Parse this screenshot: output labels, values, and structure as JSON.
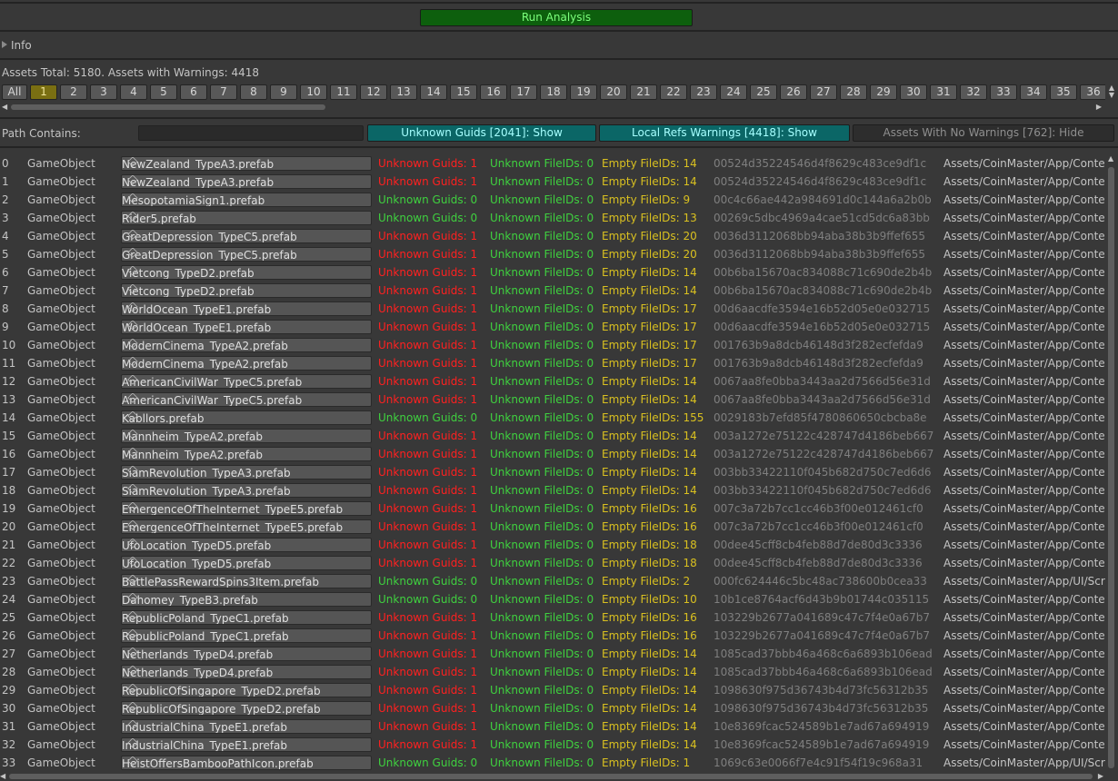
{
  "run_button": "Run Analysis",
  "info_label": "Info",
  "totals": "Assets Total: 5180. Assets with Warnings: 4418",
  "pages": [
    "All",
    "1",
    "2",
    "3",
    "4",
    "5",
    "6",
    "7",
    "8",
    "9",
    "10",
    "11",
    "12",
    "13",
    "14",
    "15",
    "16",
    "17",
    "18",
    "19",
    "20",
    "21",
    "22",
    "23",
    "24",
    "25",
    "26",
    "27",
    "28",
    "29",
    "30",
    "31",
    "32",
    "33",
    "34",
    "35",
    "36"
  ],
  "selected_page": "1",
  "path_label": "Path Contains:",
  "path_value": "",
  "toggles": {
    "unknown_guids": "Unknown Guids [2041]: Show",
    "local_refs": "Local Refs Warnings [4418]: Show",
    "no_warnings": "Assets With No Warnings [762]: Hide"
  },
  "colors": {
    "warning_red": "#ff2020",
    "ok_green": "#3fd13f",
    "empty_yellow": "#d9c020",
    "selected_page": "#7a6f12",
    "toggle_on": "#0b6666"
  },
  "icons": {
    "object_field": "prefab-cube-icon",
    "foldout": "foldout-triangle-icon"
  },
  "rows": [
    {
      "idx": "0",
      "type": "GameObject",
      "name": "NewZealand_TypeA3.prefab",
      "guids": "Unknown Guids: 1",
      "bad": true,
      "fileids": "Unknown FileIDs: 0",
      "empty": "Empty FileIDs: 14",
      "hash": "00524d35224546d4f8629c483ce9df1c",
      "path": "Assets/CoinMaster/App/Conten"
    },
    {
      "idx": "1",
      "type": "GameObject",
      "name": "NewZealand_TypeA3.prefab",
      "guids": "Unknown Guids: 1",
      "bad": true,
      "fileids": "Unknown FileIDs: 0",
      "empty": "Empty FileIDs: 14",
      "hash": "00524d35224546d4f8629c483ce9df1c",
      "path": "Assets/CoinMaster/App/Conten"
    },
    {
      "idx": "2",
      "type": "GameObject",
      "name": "MesopotamiaSign1.prefab",
      "guids": "Unknown Guids: 0",
      "bad": false,
      "fileids": "Unknown FileIDs: 0",
      "empty": "Empty FileIDs: 9",
      "hash": "00c4c66ae442a984691d0c144a6a2b0b",
      "path": "Assets/CoinMaster/App/Conten"
    },
    {
      "idx": "3",
      "type": "GameObject",
      "name": "Rider5.prefab",
      "guids": "Unknown Guids: 0",
      "bad": false,
      "fileids": "Unknown FileIDs: 0",
      "empty": "Empty FileIDs: 13",
      "hash": "00269c5dbc4969a4cae51cd5dc6a83bb",
      "path": "Assets/CoinMaster/App/Conten"
    },
    {
      "idx": "4",
      "type": "GameObject",
      "name": "GreatDepression_TypeC5.prefab",
      "guids": "Unknown Guids: 1",
      "bad": true,
      "fileids": "Unknown FileIDs: 0",
      "empty": "Empty FileIDs: 20",
      "hash": "0036d3112068bb94aba38b3b9ffef655",
      "path": "Assets/CoinMaster/App/Conten"
    },
    {
      "idx": "5",
      "type": "GameObject",
      "name": "GreatDepression_TypeC5.prefab",
      "guids": "Unknown Guids: 1",
      "bad": true,
      "fileids": "Unknown FileIDs: 0",
      "empty": "Empty FileIDs: 20",
      "hash": "0036d3112068bb94aba38b3b9ffef655",
      "path": "Assets/CoinMaster/App/Conten"
    },
    {
      "idx": "6",
      "type": "GameObject",
      "name": "Vietcong_TypeD2.prefab",
      "guids": "Unknown Guids: 1",
      "bad": true,
      "fileids": "Unknown FileIDs: 0",
      "empty": "Empty FileIDs: 14",
      "hash": "00b6ba15670ac834088c71c690de2b4b",
      "path": "Assets/CoinMaster/App/Conten"
    },
    {
      "idx": "7",
      "type": "GameObject",
      "name": "Vietcong_TypeD2.prefab",
      "guids": "Unknown Guids: 1",
      "bad": true,
      "fileids": "Unknown FileIDs: 0",
      "empty": "Empty FileIDs: 14",
      "hash": "00b6ba15670ac834088c71c690de2b4b",
      "path": "Assets/CoinMaster/App/Conten"
    },
    {
      "idx": "8",
      "type": "GameObject",
      "name": "WorldOcean_TypeE1.prefab",
      "guids": "Unknown Guids: 1",
      "bad": true,
      "fileids": "Unknown FileIDs: 0",
      "empty": "Empty FileIDs: 17",
      "hash": "00d6aacdfe3594e16b52d05e0e032715",
      "path": "Assets/CoinMaster/App/Conten"
    },
    {
      "idx": "9",
      "type": "GameObject",
      "name": "WorldOcean_TypeE1.prefab",
      "guids": "Unknown Guids: 1",
      "bad": true,
      "fileids": "Unknown FileIDs: 0",
      "empty": "Empty FileIDs: 17",
      "hash": "00d6aacdfe3594e16b52d05e0e032715",
      "path": "Assets/CoinMaster/App/Conten"
    },
    {
      "idx": "10",
      "type": "GameObject",
      "name": "ModernCinema_TypeA2.prefab",
      "guids": "Unknown Guids: 1",
      "bad": true,
      "fileids": "Unknown FileIDs: 0",
      "empty": "Empty FileIDs: 17",
      "hash": "001763b9a8dcb46148d3f282ecfefda9",
      "path": "Assets/CoinMaster/App/Conten"
    },
    {
      "idx": "11",
      "type": "GameObject",
      "name": "ModernCinema_TypeA2.prefab",
      "guids": "Unknown Guids: 1",
      "bad": true,
      "fileids": "Unknown FileIDs: 0",
      "empty": "Empty FileIDs: 17",
      "hash": "001763b9a8dcb46148d3f282ecfefda9",
      "path": "Assets/CoinMaster/App/Conten"
    },
    {
      "idx": "12",
      "type": "GameObject",
      "name": "AmericanCivilWar_TypeC5.prefab",
      "guids": "Unknown Guids: 1",
      "bad": true,
      "fileids": "Unknown FileIDs: 0",
      "empty": "Empty FileIDs: 14",
      "hash": "0067aa8fe0bba3443aa2d7566d56e31d",
      "path": "Assets/CoinMaster/App/Conten"
    },
    {
      "idx": "13",
      "type": "GameObject",
      "name": "AmericanCivilWar_TypeC5.prefab",
      "guids": "Unknown Guids: 1",
      "bad": true,
      "fileids": "Unknown FileIDs: 0",
      "empty": "Empty FileIDs: 14",
      "hash": "0067aa8fe0bba3443aa2d7566d56e31d",
      "path": "Assets/CoinMaster/App/Conten"
    },
    {
      "idx": "14",
      "type": "GameObject",
      "name": "Kabllors.prefab",
      "guids": "Unknown Guids: 0",
      "bad": false,
      "fileids": "Unknown FileIDs: 0",
      "empty": "Empty FileIDs: 155",
      "hash": "0029183b7efd85f4780860650cbcba8e",
      "path": "Assets/CoinMaster/App/Conten"
    },
    {
      "idx": "15",
      "type": "GameObject",
      "name": "Mannheim_TypeA2.prefab",
      "guids": "Unknown Guids: 1",
      "bad": true,
      "fileids": "Unknown FileIDs: 0",
      "empty": "Empty FileIDs: 14",
      "hash": "003a1272e75122c428747d4186beb667",
      "path": "Assets/CoinMaster/App/Conten"
    },
    {
      "idx": "16",
      "type": "GameObject",
      "name": "Mannheim_TypeA2.prefab",
      "guids": "Unknown Guids: 1",
      "bad": true,
      "fileids": "Unknown FileIDs: 0",
      "empty": "Empty FileIDs: 14",
      "hash": "003a1272e75122c428747d4186beb667",
      "path": "Assets/CoinMaster/App/Conten"
    },
    {
      "idx": "17",
      "type": "GameObject",
      "name": "SiamRevolution_TypeA3.prefab",
      "guids": "Unknown Guids: 1",
      "bad": true,
      "fileids": "Unknown FileIDs: 0",
      "empty": "Empty FileIDs: 14",
      "hash": "003bb33422110f045b682d750c7ed6d6",
      "path": "Assets/CoinMaster/App/Conten"
    },
    {
      "idx": "18",
      "type": "GameObject",
      "name": "SiamRevolution_TypeA3.prefab",
      "guids": "Unknown Guids: 1",
      "bad": true,
      "fileids": "Unknown FileIDs: 0",
      "empty": "Empty FileIDs: 14",
      "hash": "003bb33422110f045b682d750c7ed6d6",
      "path": "Assets/CoinMaster/App/Conten"
    },
    {
      "idx": "19",
      "type": "GameObject",
      "name": "EmergenceOfTheInternet_TypeE5.prefab",
      "guids": "Unknown Guids: 1",
      "bad": true,
      "fileids": "Unknown FileIDs: 0",
      "empty": "Empty FileIDs: 16",
      "hash": "007c3a72b7cc1cc46b3f00e012461cf0",
      "path": "Assets/CoinMaster/App/Conten"
    },
    {
      "idx": "20",
      "type": "GameObject",
      "name": "EmergenceOfTheInternet_TypeE5.prefab",
      "guids": "Unknown Guids: 1",
      "bad": true,
      "fileids": "Unknown FileIDs: 0",
      "empty": "Empty FileIDs: 16",
      "hash": "007c3a72b7cc1cc46b3f00e012461cf0",
      "path": "Assets/CoinMaster/App/Conten"
    },
    {
      "idx": "21",
      "type": "GameObject",
      "name": "UfoLocation_TypeD5.prefab",
      "guids": "Unknown Guids: 1",
      "bad": true,
      "fileids": "Unknown FileIDs: 0",
      "empty": "Empty FileIDs: 18",
      "hash": "00dee45cff8cb4feb88d7de80d3c3336",
      "path": "Assets/CoinMaster/App/Conten"
    },
    {
      "idx": "22",
      "type": "GameObject",
      "name": "UfoLocation_TypeD5.prefab",
      "guids": "Unknown Guids: 1",
      "bad": true,
      "fileids": "Unknown FileIDs: 0",
      "empty": "Empty FileIDs: 18",
      "hash": "00dee45cff8cb4feb88d7de80d3c3336",
      "path": "Assets/CoinMaster/App/Conten"
    },
    {
      "idx": "23",
      "type": "GameObject",
      "name": "BattlePassRewardSpins3Item.prefab",
      "guids": "Unknown Guids: 0",
      "bad": false,
      "fileids": "Unknown FileIDs: 0",
      "empty": "Empty FileIDs: 2",
      "hash": "000fc624446c5bc48ac738600b0cea33",
      "path": "Assets/CoinMaster/App/UI/Scre"
    },
    {
      "idx": "24",
      "type": "GameObject",
      "name": "Dahomey_TypeB3.prefab",
      "guids": "Unknown Guids: 0",
      "bad": false,
      "fileids": "Unknown FileIDs: 0",
      "empty": "Empty FileIDs: 10",
      "hash": "10b1ce8764acf6d43b9b01744c035115",
      "path": "Assets/CoinMaster/App/Conten"
    },
    {
      "idx": "25",
      "type": "GameObject",
      "name": "RepublicPoland_TypeC1.prefab",
      "guids": "Unknown Guids: 1",
      "bad": true,
      "fileids": "Unknown FileIDs: 0",
      "empty": "Empty FileIDs: 16",
      "hash": "103229b2677a041689c47c7f4e0a67b7",
      "path": "Assets/CoinMaster/App/Conten"
    },
    {
      "idx": "26",
      "type": "GameObject",
      "name": "RepublicPoland_TypeC1.prefab",
      "guids": "Unknown Guids: 1",
      "bad": true,
      "fileids": "Unknown FileIDs: 0",
      "empty": "Empty FileIDs: 16",
      "hash": "103229b2677a041689c47c7f4e0a67b7",
      "path": "Assets/CoinMaster/App/Conten"
    },
    {
      "idx": "27",
      "type": "GameObject",
      "name": "Netherlands_TypeD4.prefab",
      "guids": "Unknown Guids: 1",
      "bad": true,
      "fileids": "Unknown FileIDs: 0",
      "empty": "Empty FileIDs: 14",
      "hash": "1085cad37bbb46a468c6a6893b106ead",
      "path": "Assets/CoinMaster/App/Conten"
    },
    {
      "idx": "28",
      "type": "GameObject",
      "name": "Netherlands_TypeD4.prefab",
      "guids": "Unknown Guids: 1",
      "bad": true,
      "fileids": "Unknown FileIDs: 0",
      "empty": "Empty FileIDs: 14",
      "hash": "1085cad37bbb46a468c6a6893b106ead",
      "path": "Assets/CoinMaster/App/Conten"
    },
    {
      "idx": "29",
      "type": "GameObject",
      "name": "RepublicOfSingapore_TypeD2.prefab",
      "guids": "Unknown Guids: 1",
      "bad": true,
      "fileids": "Unknown FileIDs: 0",
      "empty": "Empty FileIDs: 14",
      "hash": "1098630f975d36743b4d73fc56312b35",
      "path": "Assets/CoinMaster/App/Conten"
    },
    {
      "idx": "30",
      "type": "GameObject",
      "name": "RepublicOfSingapore_TypeD2.prefab",
      "guids": "Unknown Guids: 1",
      "bad": true,
      "fileids": "Unknown FileIDs: 0",
      "empty": "Empty FileIDs: 14",
      "hash": "1098630f975d36743b4d73fc56312b35",
      "path": "Assets/CoinMaster/App/Conten"
    },
    {
      "idx": "31",
      "type": "GameObject",
      "name": "IndustrialChina_TypeE1.prefab",
      "guids": "Unknown Guids: 1",
      "bad": true,
      "fileids": "Unknown FileIDs: 0",
      "empty": "Empty FileIDs: 14",
      "hash": "10e8369fcac524589b1e7ad67a694919",
      "path": "Assets/CoinMaster/App/Conten"
    },
    {
      "idx": "32",
      "type": "GameObject",
      "name": "IndustrialChina_TypeE1.prefab",
      "guids": "Unknown Guids: 1",
      "bad": true,
      "fileids": "Unknown FileIDs: 0",
      "empty": "Empty FileIDs: 14",
      "hash": "10e8369fcac524589b1e7ad67a694919",
      "path": "Assets/CoinMaster/App/Conten"
    },
    {
      "idx": "33",
      "type": "GameObject",
      "name": "HeistOffersBambooPathIcon.prefab",
      "guids": "Unknown Guids: 0",
      "bad": false,
      "fileids": "Unknown FileIDs: 0",
      "empty": "Empty FileIDs: 1",
      "hash": "1069c63e0066f7e4c91f54f19c968a31",
      "path": "Assets/CoinMaster/App/UI/Scre"
    }
  ]
}
